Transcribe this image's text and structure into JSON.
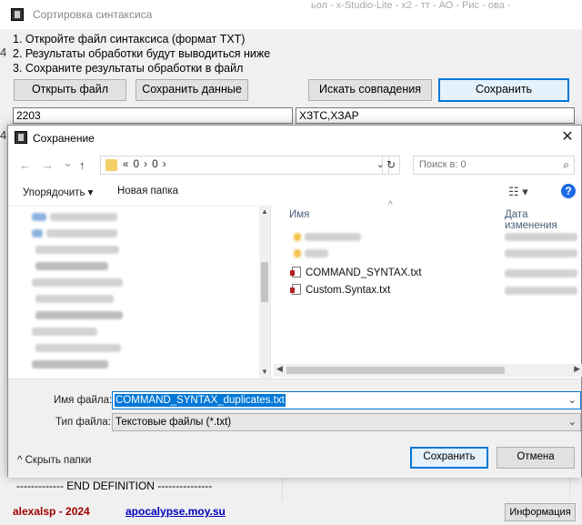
{
  "app": {
    "title": "Сортировка синтаксиса",
    "background_strip": "ьол - x-Studio-Lite - х2 - тт - АО - Рис - ова -",
    "instructions": [
      "1. Откройте файл синтаксиса (формат TXT)",
      "2. Результаты обработки будут выводиться ниже",
      "3. Сохраните результаты обработки в файл"
    ],
    "side_digit_1": "4",
    "side_digit_2": "4",
    "buttons": {
      "open_file": "Открыть файл",
      "save_data": "Сохранить данные",
      "find_matches": "Искать совпадения",
      "save": "Сохранить"
    },
    "left_field_value": "2203",
    "right_field_value": "XЗТС,XЗАР",
    "end_definition": "------------- END DEFINITION ---------------",
    "footer_author": "alexalsp - 2024",
    "footer_link": "apocalypse.moy.su",
    "info_button": "Информация"
  },
  "dialog": {
    "title": "Сохранение",
    "close_glyph": "✕",
    "nav": {
      "back": "←",
      "forward": "→",
      "recent": "⌄",
      "up": "↑",
      "breadcrumb": "« 0 › 0 ›",
      "address_dropdown": "⌄",
      "refresh": "↻",
      "search_placeholder": "Поиск в: 0",
      "search_icon": "⌕"
    },
    "toolbar": {
      "organize": "Упорядочить ▾",
      "new_folder": "Новая папка",
      "view_icon": "☷ ▾",
      "help": "?"
    },
    "columns": {
      "name": "Имя",
      "date_modified": "Дата изменения"
    },
    "files": [
      "COMMAND_SYNTAX.txt",
      "Custom.Syntax.txt"
    ],
    "file_name_label": "Имя файла:",
    "file_name_value": "COMMAND_SYNTAX_duplicates.txt",
    "file_type_label": "Тип файла:",
    "file_type_value": "Текстовые файлы (*.txt)",
    "hide_folders": "Скрыть папки",
    "save_button": "Сохранить",
    "cancel_button": "Отмена"
  }
}
